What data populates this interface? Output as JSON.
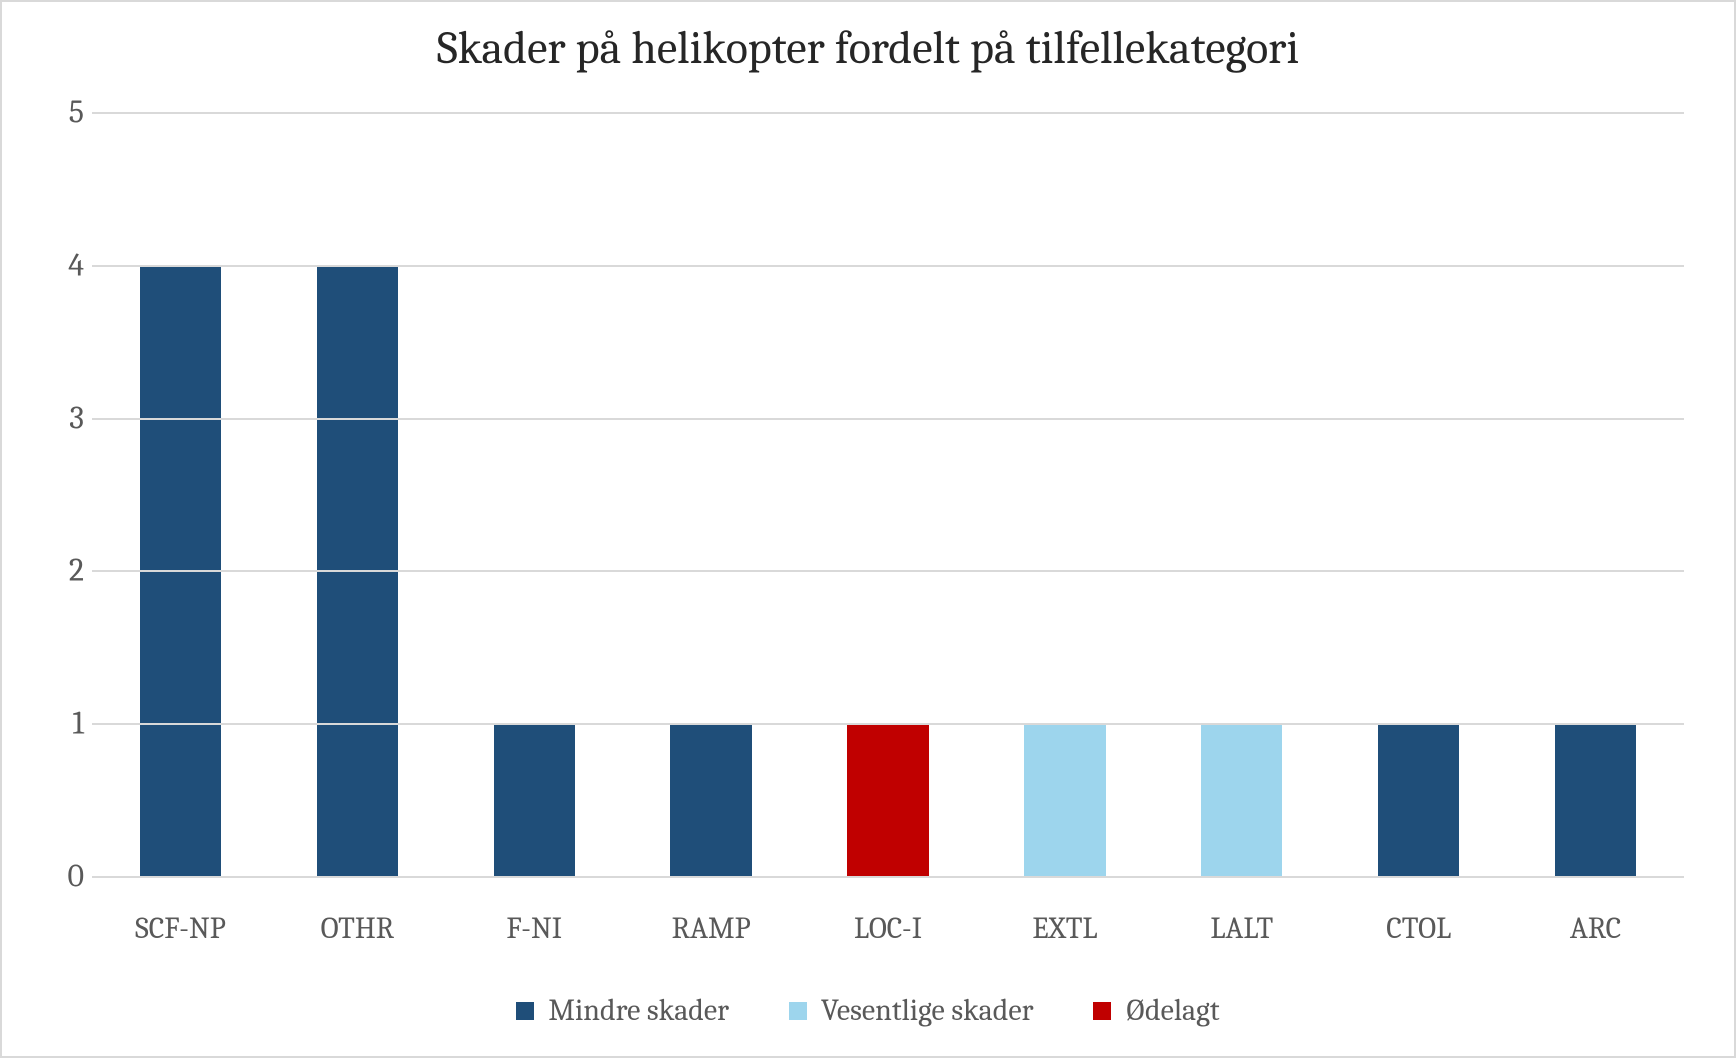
{
  "chart_data": {
    "type": "bar",
    "title": "Skader på helikopter fordelt på tilfellekategori",
    "xlabel": "",
    "ylabel": "",
    "ylim": [
      0,
      5
    ],
    "yticks": [
      0,
      1,
      2,
      3,
      4,
      5
    ],
    "categories": [
      "SCF-NP",
      "OTHR",
      "F-NI",
      "RAMP",
      "LOC-I",
      "EXTL",
      "LALT",
      "CTOL",
      "ARC"
    ],
    "series": [
      {
        "name": "Mindre skader",
        "color": "#1f4e79",
        "values": [
          4,
          4,
          1,
          1,
          0,
          0,
          0,
          1,
          1
        ]
      },
      {
        "name": "Vesentlige skader",
        "color": "#9dd5ed",
        "values": [
          0,
          0,
          0,
          0,
          0,
          1,
          1,
          0,
          0
        ]
      },
      {
        "name": "Ødelagt",
        "color": "#c00000",
        "values": [
          0,
          0,
          0,
          0,
          1,
          0,
          0,
          0,
          0
        ]
      }
    ],
    "legend_position": "bottom",
    "grid": true
  }
}
